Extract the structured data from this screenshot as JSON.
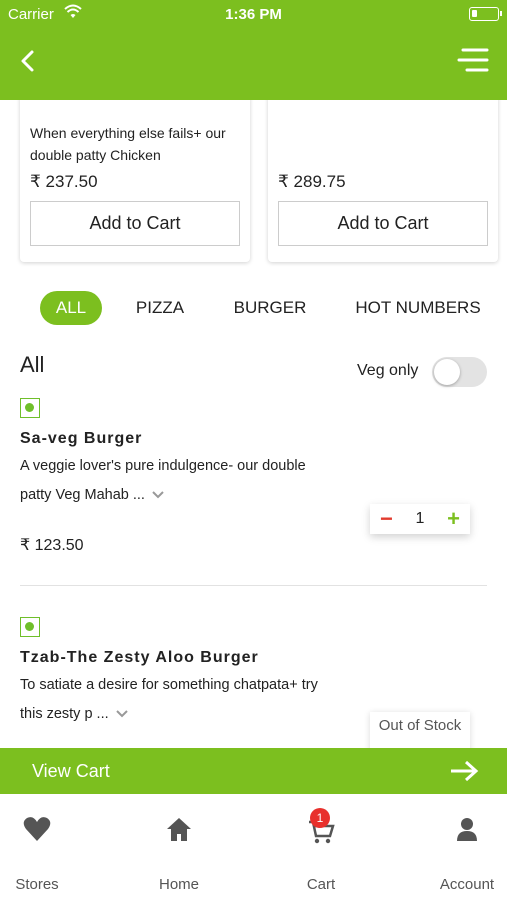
{
  "status_bar": {
    "carrier": "Carrier",
    "time": "1:36 PM"
  },
  "header": {
    "back_icon": "chevron-left-icon",
    "menu_icon": "hamburger-menu-icon"
  },
  "featured": [
    {
      "description": "When everything else fails+ our double patty Chicken",
      "price": "₹ 237.50",
      "button": "Add to Cart"
    },
    {
      "description": "",
      "price": "₹ 289.75",
      "button": "Add to Cart"
    }
  ],
  "categories": [
    {
      "label": "ALL",
      "active": true
    },
    {
      "label": "PIZZA",
      "active": false
    },
    {
      "label": "BURGER",
      "active": false
    },
    {
      "label": "HOT NUMBERS",
      "active": false
    }
  ],
  "section": {
    "title": "All",
    "veg_only_label": "Veg only",
    "veg_only_on": false
  },
  "items": [
    {
      "name": "Sa-veg Burger",
      "desc1": "A veggie lover's pure indulgence- our double",
      "desc2": "patty Veg Mahab ...",
      "price": "₹ 123.50",
      "qty": "1",
      "minus": "−",
      "plus": "+"
    },
    {
      "name": "Tzab-The Zesty Aloo Burger",
      "desc1": "To satiate a desire for something chatpata+ try",
      "desc2": "this zesty p ...",
      "stock": "Out of Stock"
    }
  ],
  "view_cart": {
    "label": "View Cart"
  },
  "tabbar": {
    "items": [
      {
        "label": "Stores",
        "icon": "heart-icon"
      },
      {
        "label": "Home",
        "icon": "home-icon"
      },
      {
        "label": "Cart",
        "icon": "cart-icon",
        "badge": "1"
      },
      {
        "label": "Account",
        "icon": "person-icon"
      }
    ]
  },
  "colors": {
    "brand": "#7cbf1f",
    "badge": "#e8302c",
    "minus": "#e23b2e"
  }
}
